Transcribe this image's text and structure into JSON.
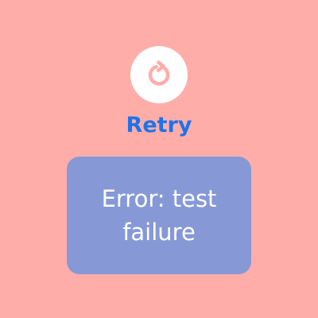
{
  "retry": {
    "icon": "refresh-icon",
    "label": "Retry"
  },
  "error": {
    "message": "Error: test failure"
  },
  "colors": {
    "background": "#FFADA9",
    "retry_circle": "#FFFFFF",
    "retry_icon": "#FFADA9",
    "retry_label": "#1E73EA",
    "error_box": "#8699D6",
    "error_text": "#FFFFFF"
  }
}
